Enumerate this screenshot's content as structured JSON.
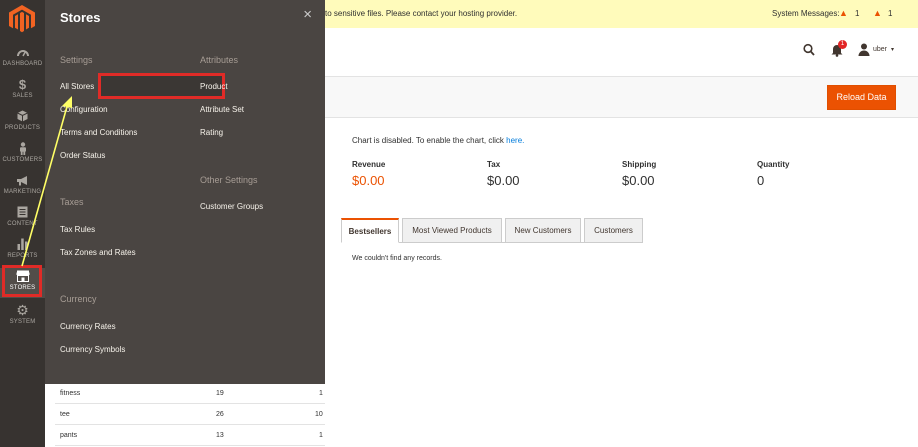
{
  "rail": {
    "items": [
      {
        "label": "DASHBOARD",
        "icon": "dashboard-icon"
      },
      {
        "label": "SALES",
        "icon": "dollar-icon"
      },
      {
        "label": "PRODUCTS",
        "icon": "box-icon"
      },
      {
        "label": "CUSTOMERS",
        "icon": "person-icon"
      },
      {
        "label": "MARKETING",
        "icon": "megaphone-icon"
      },
      {
        "label": "CONTENT",
        "icon": "content-icon"
      },
      {
        "label": "REPORTS",
        "icon": "bar-chart-icon"
      },
      {
        "label": "STORES",
        "icon": "storefront-icon"
      },
      {
        "label": "SYSTEM",
        "icon": "gear-icon"
      }
    ]
  },
  "flyout": {
    "title": "Stores",
    "close": "×",
    "settings_head": "Settings",
    "settings": [
      "All Stores",
      "Configuration",
      "Terms and Conditions",
      "Order Status"
    ],
    "taxes_head": "Taxes",
    "taxes": [
      "Tax Rules",
      "Tax Zones and Rates"
    ],
    "currency_head": "Currency",
    "currency": [
      "Currency Rates",
      "Currency Symbols"
    ],
    "attributes_head": "Attributes",
    "attributes": [
      "Product",
      "Attribute Set",
      "Rating"
    ],
    "other_head": "Other Settings",
    "other": [
      "Customer Groups"
    ]
  },
  "messages": {
    "text": "to sensitive files. Please contact your hosting provider.",
    "system_label": "System Messages:",
    "warn1_count": "1",
    "warn2_count": "1"
  },
  "header": {
    "notification_count": "1",
    "user": "uber",
    "caret": "▾"
  },
  "actions": {
    "reload": "Reload Data"
  },
  "dashboard": {
    "chart_note": "Chart is disabled. To enable the chart, click ",
    "chart_link": "here.",
    "stats": [
      {
        "label": "Revenue",
        "value": "$0.00"
      },
      {
        "label": "Tax",
        "value": "$0.00"
      },
      {
        "label": "Shipping",
        "value": "$0.00"
      },
      {
        "label": "Quantity",
        "value": "0"
      }
    ],
    "tabs": [
      "Bestsellers",
      "Most Viewed Products",
      "New Customers",
      "Customers"
    ],
    "empty": "We couldn't find any records."
  },
  "search_terms": {
    "rows": [
      {
        "term": "fitness",
        "results": "19",
        "uses": "1"
      },
      {
        "term": "tee",
        "results": "26",
        "uses": "10"
      },
      {
        "term": "pants",
        "results": "13",
        "uses": "1"
      }
    ]
  }
}
